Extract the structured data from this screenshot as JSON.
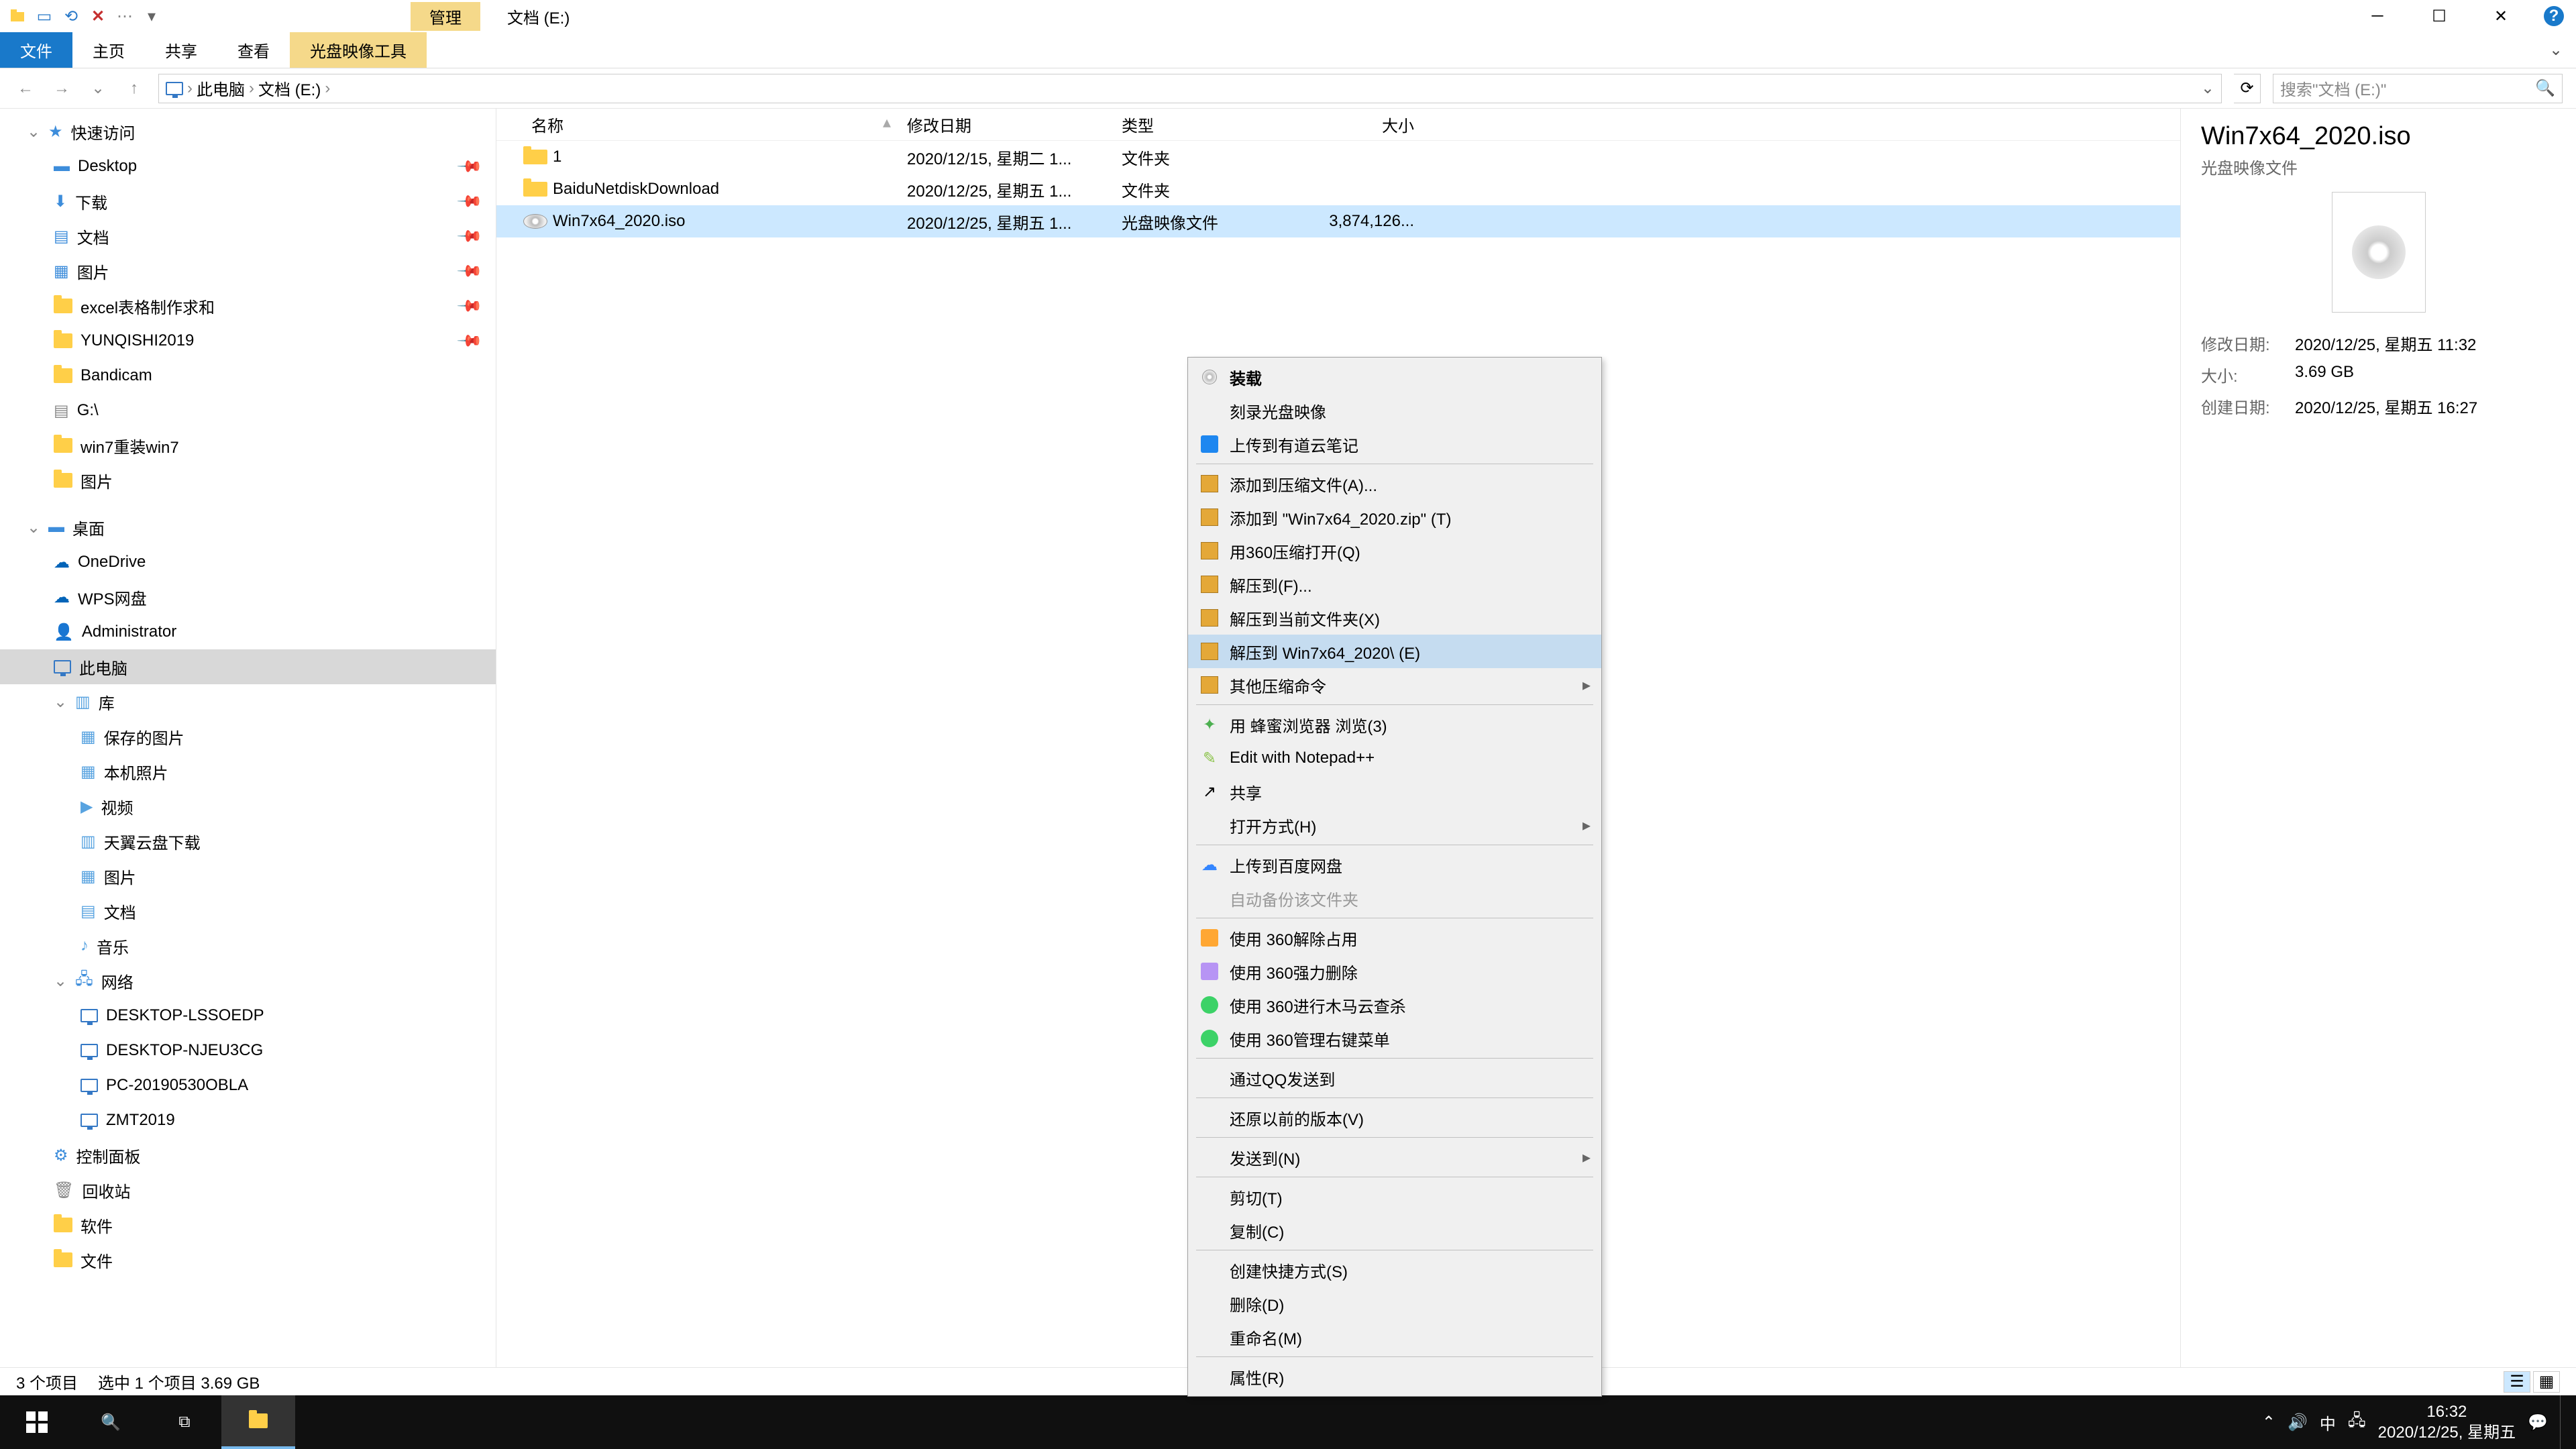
{
  "titlebar": {
    "context_tab": "管理",
    "title": "文档 (E:)"
  },
  "ribbon": {
    "file": "文件",
    "home": "主页",
    "share": "共享",
    "view": "查看",
    "tool": "光盘映像工具"
  },
  "nav": {
    "crumb1": "此电脑",
    "crumb2": "文档 (E:)",
    "search_placeholder": "搜索\"文档 (E:)\""
  },
  "tree": {
    "quick": "快速访问",
    "desktop": "Desktop",
    "downloads": "下载",
    "documents": "文档",
    "pictures": "图片",
    "excel": "excel表格制作求和",
    "yunqishi": "YUNQISHI2019",
    "bandicam": "Bandicam",
    "gdrive": "G:\\",
    "win7reinstall": "win7重装win7",
    "pictures2": "图片",
    "desktop_root": "桌面",
    "onedrive": "OneDrive",
    "wps": "WPS网盘",
    "admin": "Administrator",
    "thispc": "此电脑",
    "libraries": "库",
    "savedpics": "保存的图片",
    "localpics": "本机照片",
    "videos": "视频",
    "tianyi": "天翼云盘下载",
    "lib_pictures": "图片",
    "lib_docs": "文档",
    "lib_music": "音乐",
    "network": "网络",
    "net1": "DESKTOP-LSSOEDP",
    "net2": "DESKTOP-NJEU3CG",
    "net3": "PC-20190530OBLA",
    "net4": "ZMT2019",
    "ctrlpanel": "控制面板",
    "recycle": "回收站",
    "software": "软件",
    "filefolder": "文件"
  },
  "cols": {
    "name": "名称",
    "date": "修改日期",
    "type": "类型",
    "size": "大小"
  },
  "files": [
    {
      "name": "1",
      "date": "2020/12/15, 星期二 1...",
      "type": "文件夹",
      "size": ""
    },
    {
      "name": "BaiduNetdiskDownload",
      "date": "2020/12/25, 星期五 1...",
      "type": "文件夹",
      "size": ""
    },
    {
      "name": "Win7x64_2020.iso",
      "date": "2020/12/25, 星期五 1...",
      "type": "光盘映像文件",
      "size": "3,874,126..."
    }
  ],
  "details": {
    "title": "Win7x64_2020.iso",
    "subtitle": "光盘映像文件",
    "modified_k": "修改日期:",
    "modified_v": "2020/12/25, 星期五 11:32",
    "size_k": "大小:",
    "size_v": "3.69 GB",
    "created_k": "创建日期:",
    "created_v": "2020/12/25, 星期五 16:27"
  },
  "ctx": [
    {
      "label": "装载",
      "bold": true,
      "icon": "disc"
    },
    {
      "label": "刻录光盘映像"
    },
    {
      "label": "上传到有道云笔记",
      "icon": "blue"
    },
    {
      "sep": true
    },
    {
      "label": "添加到压缩文件(A)...",
      "icon": "archive"
    },
    {
      "label": "添加到 \"Win7x64_2020.zip\" (T)",
      "icon": "archive"
    },
    {
      "label": "用360压缩打开(Q)",
      "icon": "archive"
    },
    {
      "label": "解压到(F)...",
      "icon": "archive"
    },
    {
      "label": "解压到当前文件夹(X)",
      "icon": "archive"
    },
    {
      "label": "解压到 Win7x64_2020\\ (E)",
      "icon": "archive",
      "hov": true
    },
    {
      "label": "其他压缩命令",
      "icon": "archive",
      "sub": true
    },
    {
      "sep": true
    },
    {
      "label": "用 蜂蜜浏览器 浏览(3)",
      "icon": "green"
    },
    {
      "label": "Edit with Notepad++",
      "icon": "npp"
    },
    {
      "label": "共享",
      "icon": "share"
    },
    {
      "label": "打开方式(H)",
      "sub": true
    },
    {
      "sep": true
    },
    {
      "label": "上传到百度网盘",
      "icon": "baidu"
    },
    {
      "label": "自动备份该文件夹",
      "disabled": true
    },
    {
      "sep": true
    },
    {
      "label": "使用 360解除占用",
      "icon": "360"
    },
    {
      "label": "使用 360强力删除",
      "icon": "360d"
    },
    {
      "label": "使用 360进行木马云查杀",
      "icon": "360y"
    },
    {
      "label": "使用 360管理右键菜单",
      "icon": "360y"
    },
    {
      "sep": true
    },
    {
      "label": "通过QQ发送到"
    },
    {
      "sep": true
    },
    {
      "label": "还原以前的版本(V)"
    },
    {
      "sep": true
    },
    {
      "label": "发送到(N)",
      "sub": true
    },
    {
      "sep": true
    },
    {
      "label": "剪切(T)"
    },
    {
      "label": "复制(C)"
    },
    {
      "sep": true
    },
    {
      "label": "创建快捷方式(S)"
    },
    {
      "label": "删除(D)"
    },
    {
      "label": "重命名(M)"
    },
    {
      "sep": true
    },
    {
      "label": "属性(R)"
    }
  ],
  "status": {
    "count": "3 个项目",
    "selected": "选中 1 个项目  3.69 GB"
  },
  "taskbar": {
    "time": "16:32",
    "date": "2020/12/25, 星期五",
    "ime": "中"
  }
}
